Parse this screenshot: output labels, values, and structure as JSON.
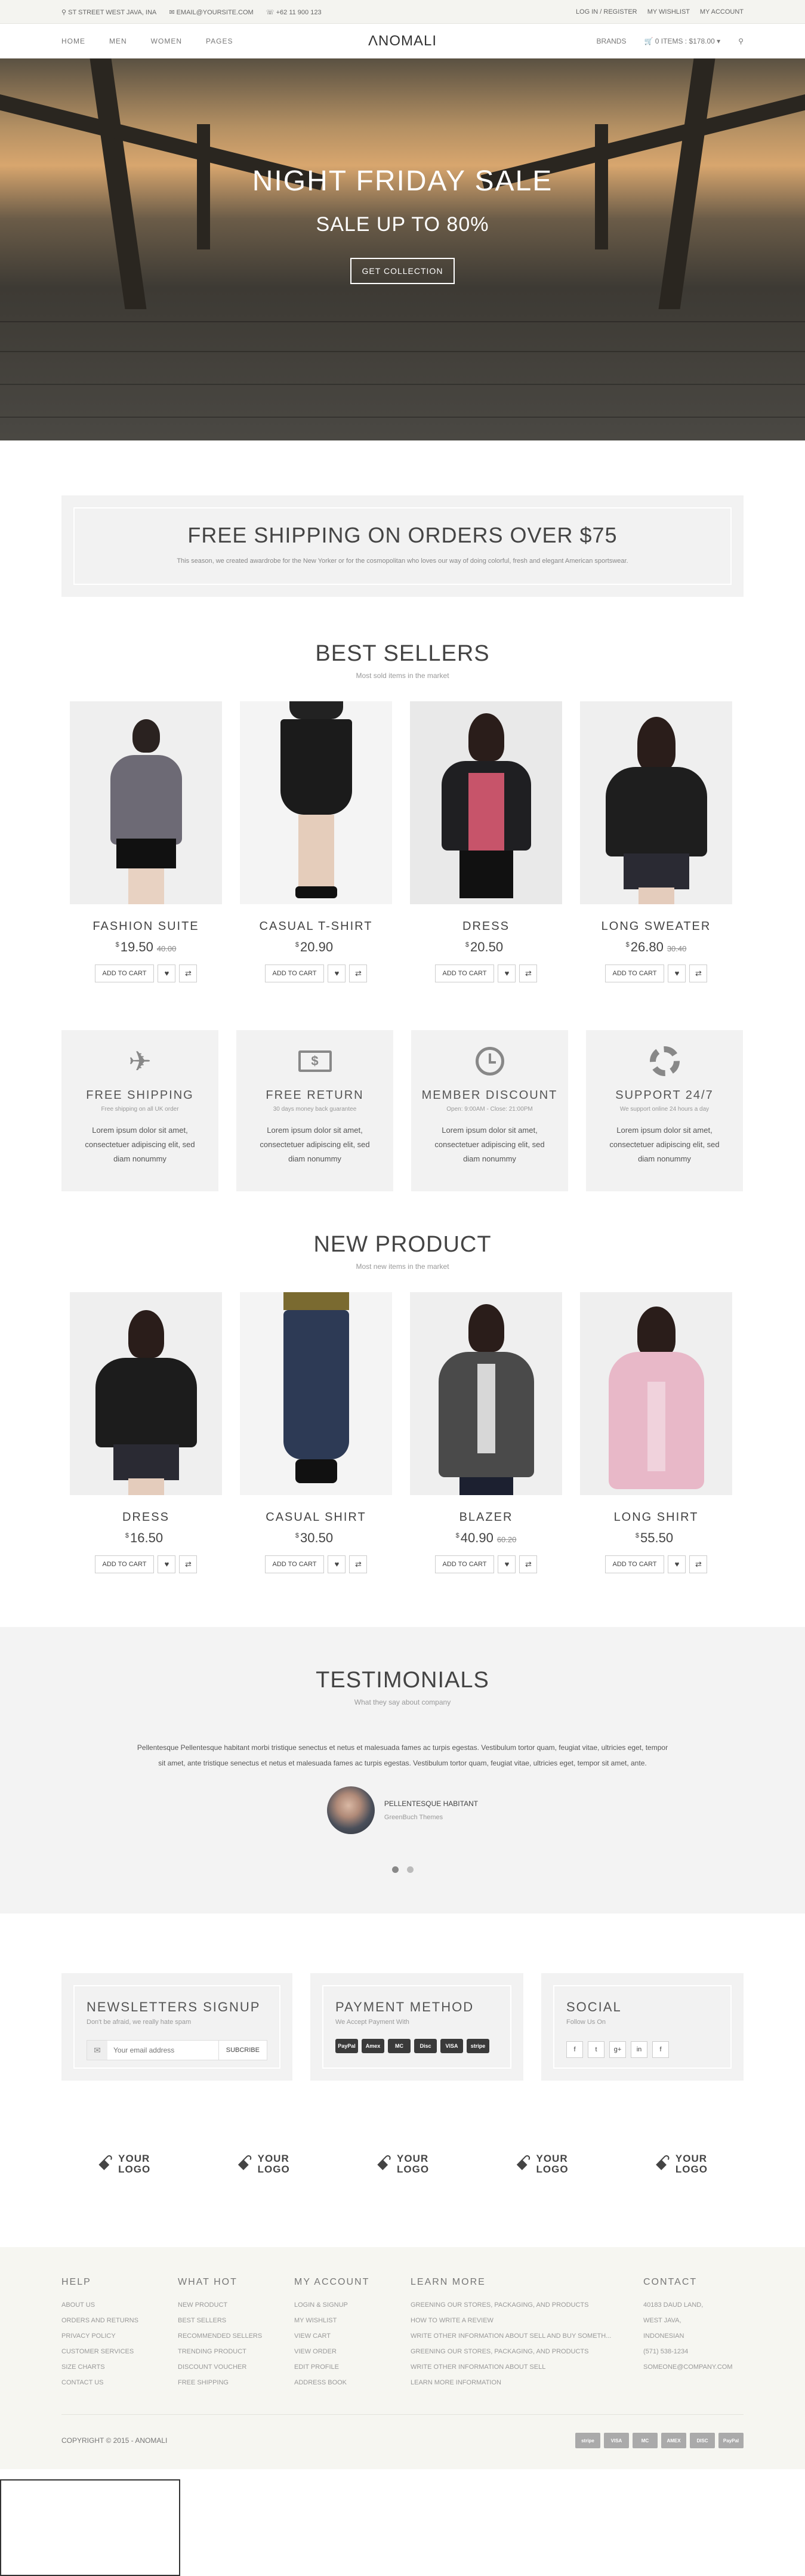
{
  "topbar": {
    "address": "ST STREET WEST JAVA, INA",
    "email": "EMAIL@YOURSITE.COM",
    "phone": "+62 11 900 123",
    "login": "LOG IN / REGISTER",
    "wishlist": "MY WISHLIST",
    "account": "MY ACCOUNT"
  },
  "nav": {
    "items": [
      "HOME",
      "MEN",
      "WOMEN",
      "PAGES"
    ],
    "logo": "ΛNOMALI",
    "brands": "BRANDS",
    "cart": "0 ITEMS : $178.00"
  },
  "hero": {
    "title": "NIGHT FRIDAY SALE",
    "subtitle": "SALE UP TO 80%",
    "button": "GET COLLECTION"
  },
  "shipping": {
    "title": "FREE SHIPPING ON ORDERS OVER $75",
    "text": "This season, we created awardrobe for the New Yorker or for the cosmopolitan who loves our way of doing colorful, fresh and elegant American sportswear."
  },
  "best_sellers": {
    "title": "BEST SELLERS",
    "subtitle": "Most sold items in the market",
    "products": [
      {
        "name": "FASHION SUITE",
        "currency": "$",
        "price": "19.50",
        "old": "40.00"
      },
      {
        "name": "CASUAL T-SHIRT",
        "currency": "$",
        "price": "20.90",
        "old": ""
      },
      {
        "name": "DRESS",
        "currency": "$",
        "price": "20.50",
        "old": ""
      },
      {
        "name": "LONG SWEATER",
        "currency": "$",
        "price": "26.80",
        "old": "30.40"
      }
    ]
  },
  "cart_labels": {
    "add": "ADD TO CART",
    "wish": "♥",
    "compare": "⇄"
  },
  "features": [
    {
      "title": "FREE SHIPPING",
      "sub": "Free shipping on all UK order",
      "text": "Lorem ipsum dolor sit amet, consectetuer adipiscing elit, sed diam nonummy",
      "icon": "airplane-icon"
    },
    {
      "title": "FREE RETURN",
      "sub": "30 days money back guarantee",
      "text": "Lorem ipsum dolor sit amet, consectetuer adipiscing elit, sed diam nonummy",
      "icon": "money-icon"
    },
    {
      "title": "MEMBER DISCOUNT",
      "sub": "Open: 9:00AM - Close: 21:00PM",
      "text": "Lorem ipsum dolor sit amet, consectetuer adipiscing elit, sed diam nonummy",
      "icon": "clock-icon"
    },
    {
      "title": "SUPPORT 24/7",
      "sub": "We support online 24 hours a day",
      "text": "Lorem ipsum dolor sit amet, consectetuer adipiscing elit, sed diam nonummy",
      "icon": "lifebuoy-icon"
    }
  ],
  "new_product": {
    "title": "NEW PRODUCT",
    "subtitle": "Most new items in the market",
    "products": [
      {
        "name": "DRESS",
        "currency": "$",
        "price": "16.50",
        "old": ""
      },
      {
        "name": "CASUAL SHIRT",
        "currency": "$",
        "price": "30.50",
        "old": ""
      },
      {
        "name": "BLAZER",
        "currency": "$",
        "price": "40.90",
        "old": "60.20"
      },
      {
        "name": "LONG SHIRT",
        "currency": "$",
        "price": "55.50",
        "old": ""
      }
    ]
  },
  "testimonials": {
    "title": "TESTIMONIALS",
    "subtitle": "What they say about company",
    "quote": "Pellentesque Pellentesque habitant morbi tristique senectus et netus et malesuada fames ac turpis egestas. Vestibulum tortor quam, feugiat vitae, ultricies eget, tempor sit amet, ante tristique senectus et netus et malesuada fames ac turpis egestas. Vestibulum tortor quam, feugiat vitae, ultricies eget, tempor sit amet, ante.",
    "name": "PELLENTESQUE HABITANT",
    "company": "GreenBuch Themes"
  },
  "newsletter": {
    "title": "NEWSLETTERS SIGNUP",
    "sub": "Don't be afraid, we really hate spam",
    "placeholder": "Your email address",
    "button": "SUBCRIBE"
  },
  "payment": {
    "title": "PAYMENT METHOD",
    "sub": "We Accept Payment With",
    "cards": [
      "PayPal",
      "Amex",
      "MC",
      "Disc",
      "VISA",
      "stripe"
    ]
  },
  "social": {
    "title": "SOCIAL",
    "sub": "Follow Us On",
    "icons": [
      "f",
      "t",
      "g+",
      "in",
      "f"
    ]
  },
  "logos": [
    {
      "line1": "YOUR",
      "line2": "LOGO"
    },
    {
      "line1": "YOUR",
      "line2": "LOGO"
    },
    {
      "line1": "YOUR",
      "line2": "LOGO"
    },
    {
      "line1": "YOUR",
      "line2": "LOGO"
    },
    {
      "line1": "YOUR",
      "line2": "LOGO"
    }
  ],
  "footer": {
    "columns": [
      {
        "title": "HELP",
        "items": [
          "ABOUT US",
          "ORDERS AND RETURNS",
          "PRIVACY POLICY",
          "CUSTOMER SERVICES",
          "SIZE CHARTS",
          "CONTACT US"
        ]
      },
      {
        "title": "WHAT HOT",
        "items": [
          "NEW PRODUCT",
          "BEST SELLERS",
          "RECOMMENDED SELLERS",
          "TRENDING PRODUCT",
          "DISCOUNT VOUCHER",
          "FREE SHIPPING"
        ]
      },
      {
        "title": "MY ACCOUNT",
        "items": [
          "LOGIN & SIGNUP",
          "MY WISHLIST",
          "VIEW CART",
          "VIEW ORDER",
          "EDIT PROFILE",
          "ADDRESS BOOK"
        ]
      },
      {
        "title": "LEARN MORE",
        "items": [
          "GREENING OUR STORES, PACKAGING, AND PRODUCTS",
          "HOW TO WRITE A REVIEW",
          "WRITE OTHER INFORMATION ABOUT SELL AND BUY SOMETH...",
          "GREENING OUR STORES, PACKAGING, AND PRODUCTS",
          "WRITE OTHER INFORMATION ABOUT SELL",
          "LEARN MORE INFORMATION"
        ]
      },
      {
        "title": "CONTACT",
        "items": [
          "40183 DAUD LAND,",
          "WEST JAVA,",
          "INDONESIAN",
          "(571) 538-1234",
          "SOMEONE@COMPANY.COM"
        ]
      }
    ],
    "copyright": "COPYRIGHT © 2015 - ANOMALI",
    "cards": [
      "stripe",
      "VISA",
      "MC",
      "AMEX",
      "DISC",
      "PayPal"
    ]
  },
  "colors": {
    "accent": "#444444",
    "panel": "#f2f2f2",
    "footer_bg": "#f6f6f1"
  }
}
